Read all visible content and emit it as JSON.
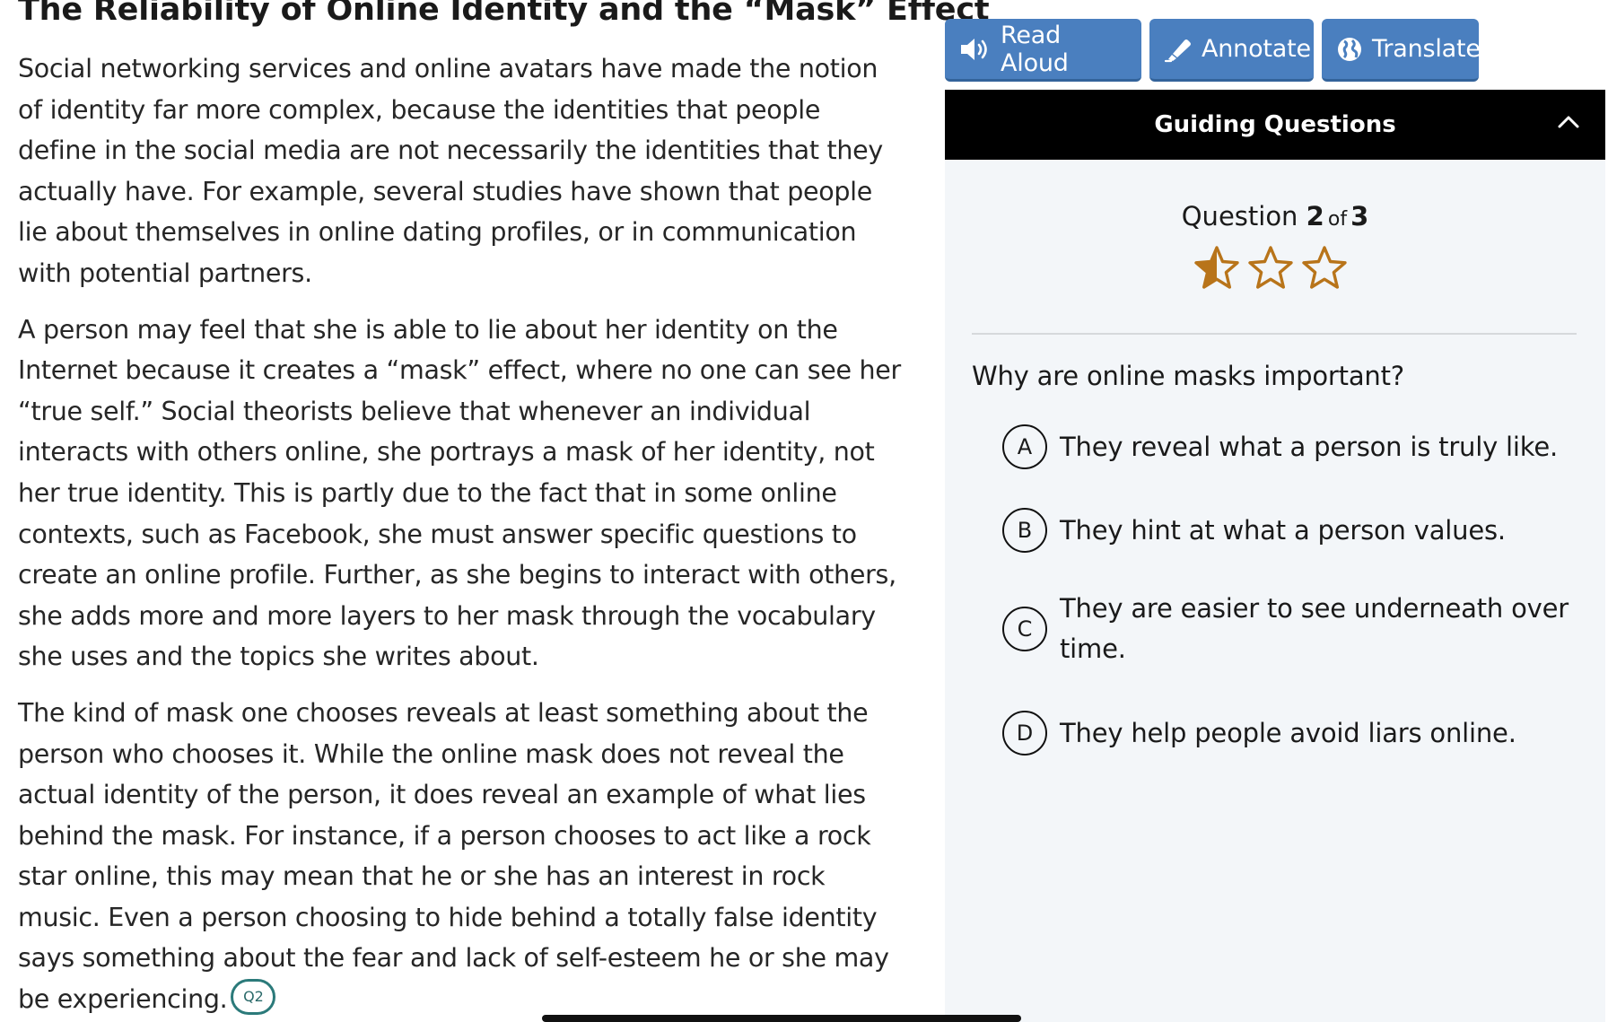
{
  "article": {
    "title": "The Reliability of Online Identity and the “Mask” Effect",
    "paragraphs": [
      "Social networking services and online avatars have made the notion of identity far more complex, because the identities that people define in the social media are not necessarily the identities that they actually have. For example, several studies have shown that people lie about themselves in online dating profiles, or in communication with potential partners.",
      "A person may feel that she is able to lie about her identity on the Internet because it creates a “mask” effect, where no one can see her “true self.” Social theorists believe that whenever an individual interacts with others online, she portrays a mask of her identity, not her true identity. This is partly due to the fact that in some online contexts, such as Facebook, she must answer specific questions to create an online profile. Further, as she begins to interact with others, she adds more and more layers to her mask through the vocabulary she uses and the topics she writes about.",
      "The kind of mask one chooses reveals at least something about the person who chooses it. While the online mask does not reveal the actual identity of the person, it does reveal an example of what lies behind the mask. For instance, if a person chooses to act like a rock star online, this may mean that he or she has an interest in rock music. Even a person choosing to hide behind a totally false identity says something about the fear and lack of self-esteem he or she may be experiencing."
    ],
    "question_marker": "Q2"
  },
  "toolbar": {
    "read_aloud": "Read Aloud",
    "annotate": "Annotate",
    "translate": "Translate",
    "icons": [
      "speaker-icon",
      "highlighter-icon",
      "globe-icon"
    ]
  },
  "guiding": {
    "header": "Guiding Questions",
    "question_label": "Question",
    "current": "2",
    "of_label": "of",
    "total": "3",
    "rating": {
      "filled_fraction": 0.5,
      "max_stars": 3
    },
    "question": "Why are online masks important?",
    "options": [
      {
        "letter": "A",
        "text": "They reveal what a person is truly like."
      },
      {
        "letter": "B",
        "text": "They hint at what a person values."
      },
      {
        "letter": "C",
        "text": "They are easier to see underneath over time."
      },
      {
        "letter": "D",
        "text": "They help people avoid liars online."
      }
    ]
  },
  "colors": {
    "toolbar_button": "#4a7fbf",
    "header_bg": "#000000",
    "panel_bg": "#f3f6f9",
    "star": "#b8741a",
    "marker": "#2b7a7a"
  }
}
